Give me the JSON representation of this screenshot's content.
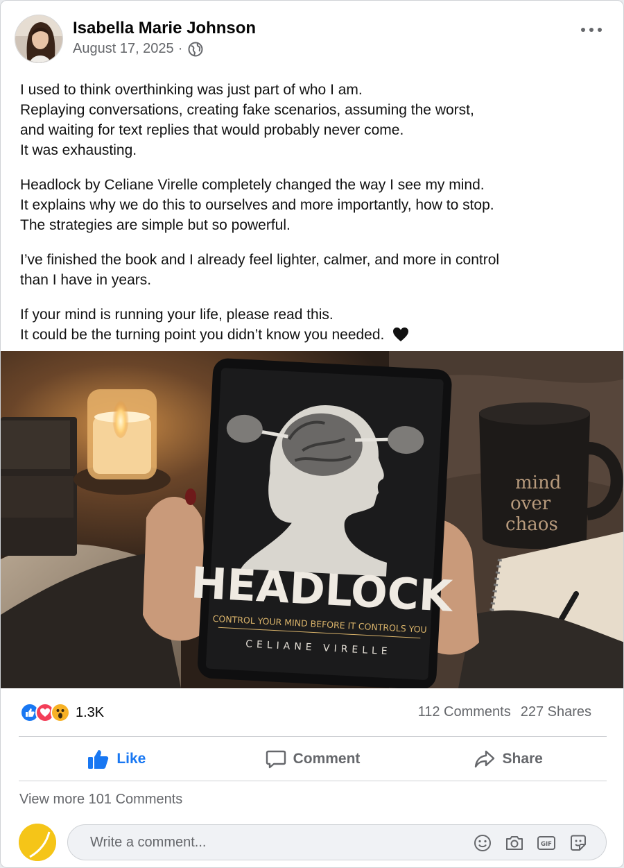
{
  "post": {
    "author": "Isabella Marie Johnson",
    "date": "August 17, 2025",
    "separator": "·",
    "privacy_icon": "globe-icon",
    "more_icon": "more-dots-icon",
    "paragraphs": [
      [
        "I used to think overthinking was just part of who I am.",
        "Replaying conversations, creating fake scenarios, assuming the worst,",
        "and waiting for text replies that would probably never come.",
        "It was exhausting."
      ],
      [
        "Headlock by Celiane Virelle completely changed the way I see my mind.",
        "It explains why we do this to ourselves and more importantly, how to stop.",
        "The strategies are simple but so powerful."
      ],
      [
        "I’ve finished the book and I already feel lighter, calmer, and more in control",
        "than I have in years."
      ],
      [
        "If your mind is running your life, please read this.",
        "It could be the turning point you didn’t know you needed."
      ]
    ],
    "emoji": "black-heart"
  },
  "photo": {
    "book_title": "HEADLOCK",
    "book_subtitle": "CONTROL YOUR MIND BEFORE IT CONTROLS YOU",
    "book_author": "CELIANE VIRELLE",
    "mug_text": [
      "mind",
      "over",
      "chaos"
    ]
  },
  "engagement": {
    "reaction_icons": [
      "like-reaction-icon",
      "love-reaction-icon",
      "wow-reaction-icon"
    ],
    "reaction_count": "1.3K",
    "comments": "112 Comments",
    "shares": "227 Shares"
  },
  "actions": {
    "like": "Like",
    "comment": "Comment",
    "share": "Share"
  },
  "comments_section": {
    "view_more": "View more 101 Comments",
    "placeholder": "Write a comment...",
    "tools": [
      "emoji-icon",
      "camera-icon",
      "gif-icon",
      "sticker-icon"
    ]
  },
  "colors": {
    "brand_blue": "#1877f2",
    "secondary_text": "#65676b",
    "love_red": "#f33e58",
    "wow_yellow": "#f7b125"
  }
}
